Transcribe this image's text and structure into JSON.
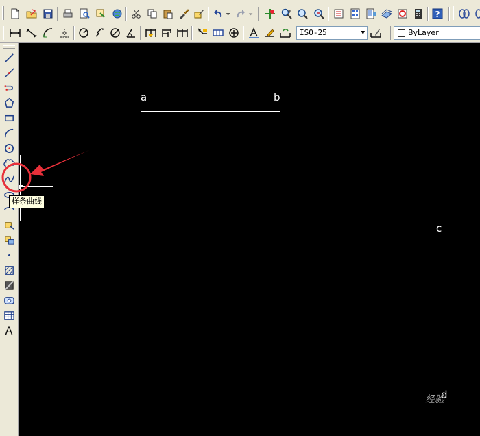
{
  "toolbar_top": {
    "buttons": [
      {
        "name": "new-file",
        "icon": "new-document-icon"
      },
      {
        "name": "open",
        "icon": "open-folder-icon"
      },
      {
        "name": "save",
        "icon": "save-icon"
      },
      {
        "name": "print",
        "icon": "printer-icon"
      },
      {
        "name": "print-preview",
        "icon": "print-preview-icon"
      },
      {
        "name": "publish",
        "icon": "publish-icon"
      },
      {
        "name": "web",
        "icon": "globe-icon"
      },
      {
        "name": "cut",
        "icon": "scissors-icon"
      },
      {
        "name": "copy",
        "icon": "copy-icon"
      },
      {
        "name": "paste",
        "icon": "paste-icon"
      },
      {
        "name": "match-properties",
        "icon": "brush-icon"
      },
      {
        "name": "block-editor",
        "icon": "block-edit-icon"
      },
      {
        "name": "undo",
        "icon": "undo-icon"
      },
      {
        "name": "redo",
        "icon": "redo-icon"
      },
      {
        "name": "pan",
        "icon": "pan-icon"
      },
      {
        "name": "zoom-realtime",
        "icon": "zoom-realtime-icon"
      },
      {
        "name": "zoom-window",
        "icon": "zoom-window-icon"
      },
      {
        "name": "zoom-previous",
        "icon": "zoom-previous-icon"
      },
      {
        "name": "properties",
        "icon": "properties-icon"
      },
      {
        "name": "design-center",
        "icon": "design-center-icon"
      },
      {
        "name": "tool-palettes",
        "icon": "tool-palette-icon"
      },
      {
        "name": "sheet-set",
        "icon": "sheet-set-icon"
      },
      {
        "name": "markup",
        "icon": "markup-icon"
      },
      {
        "name": "calculator",
        "icon": "calculator-icon"
      },
      {
        "name": "help",
        "icon": "help-icon",
        "label": "?"
      },
      {
        "name": "3d-orbit",
        "icon": "orbit-icon"
      }
    ]
  },
  "toolbar_dim": {
    "dimstyle_value": "ISO-25",
    "layer_value": "ByLayer"
  },
  "draw_toolbar": {
    "tools": [
      "line-icon",
      "construction-line-icon",
      "polyline-icon",
      "polygon-icon",
      "rectangle-icon",
      "arc-icon",
      "circle-icon",
      "revision-cloud-icon",
      "spline-icon",
      "ellipse-icon",
      "ellipse-arc-icon",
      "insert-block-icon",
      "make-block-icon",
      "point-icon",
      "hatch-icon",
      "gradient-icon",
      "region-icon",
      "table-icon",
      "multiline-text-icon"
    ],
    "text_tool_label": "A"
  },
  "tooltip": {
    "text": "样条曲线"
  },
  "canvas": {
    "labels": {
      "a": "a",
      "b": "b",
      "c": "c",
      "d": "d"
    }
  },
  "watermark": "经验",
  "colors": {
    "toolbar_bg": "#ece9d8",
    "canvas_bg": "#000000",
    "highlight": "#e8303a",
    "tooltip_bg": "#ffffe1"
  }
}
